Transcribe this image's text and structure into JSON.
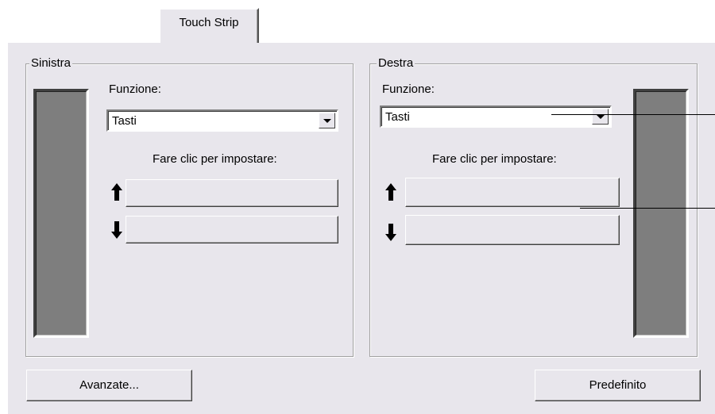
{
  "tab": {
    "label": "Touch Strip"
  },
  "left": {
    "legend": "Sinistra",
    "function_label": "Funzione:",
    "function_value": "Tasti",
    "click_label": "Fare clic per impostare:"
  },
  "right": {
    "legend": "Destra",
    "function_label": "Funzione:",
    "function_value": "Tasti",
    "click_label": "Fare clic per impostare:"
  },
  "buttons": {
    "advanced": "Avanzate...",
    "default": "Predefinito"
  },
  "icons": {
    "up": "arrow-up-icon",
    "down": "arrow-down-icon",
    "dropdown": "chevron-down-icon"
  }
}
